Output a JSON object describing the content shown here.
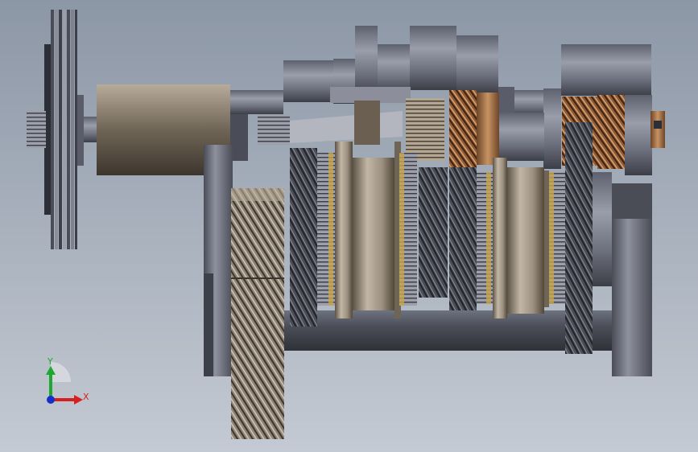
{
  "viewport": {
    "background_top": "#8c97a6",
    "background_bottom": "#c4cad3"
  },
  "colors": {
    "steel_dark": "#3e4049",
    "steel_mid": "#6a6d7a",
    "steel_light": "#a3a6b2",
    "tan_dark": "#4a4238",
    "tan_mid": "#8a7e6e",
    "tan_light": "#bfb2a0",
    "bronze_dark": "#5a3a22",
    "bronze_light": "#c79363",
    "gold": "#c8a54a",
    "triad_x": "#d62020",
    "triad_y": "#1ea830",
    "triad_z": "#1530c8"
  },
  "triad": {
    "x_label": "X",
    "y_label": "Y"
  }
}
